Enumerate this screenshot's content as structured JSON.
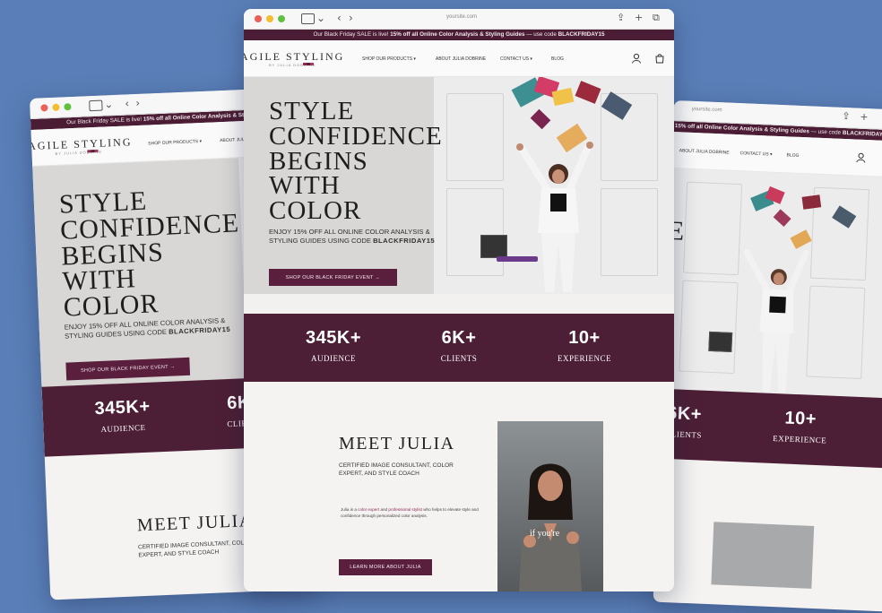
{
  "browser": {
    "url": "yoursite.com",
    "icons": [
      "sidebar-icon",
      "chevron-down-icon",
      "back-icon",
      "forward-icon",
      "share-icon",
      "new-tab-icon",
      "tabs-icon"
    ]
  },
  "banner": {
    "text_left": "Our Black Friday SALE is live!",
    "text_bold": "15% off all Online Color Analysis & Styling Guides",
    "text_right": "— use code",
    "code": "BLACKFRIDAY15"
  },
  "site": {
    "logo": "AGILE STYLING",
    "logo_sub": "BY JULIA DOBRINE",
    "menu": [
      "SHOP OUR PRODUCTS ▾",
      "ABOUT JULIA DOBRINE",
      "CONTACT US ▾",
      "BLOG"
    ]
  },
  "hero": {
    "heading": [
      "STYLE",
      "CONFIDENCE",
      "BEGINS",
      "WITH",
      "COLOR"
    ],
    "sub_line1": "ENJOY 15% OFF ALL ONLINE COLOR ANALYSIS &",
    "sub_line2": "STYLING GUIDES USING CODE",
    "code": "BLACKFRIDAY15",
    "cta": "SHOP OUR BLACK FRIDAY EVENT →"
  },
  "stats": [
    {
      "value": "345K+",
      "label": "AUDIENCE"
    },
    {
      "value": "6K+",
      "label": "CLIENTS"
    },
    {
      "value": "10+",
      "label": "EXPERIENCE"
    }
  ],
  "meet": {
    "title": "MEET JULIA",
    "subtitle_line1": "CERTIFIED IMAGE CONSULTANT, COLOR",
    "subtitle_line2": "EXPERT, AND STYLE COACH",
    "body_a": "Julia is a ",
    "body_hl1": "color expert",
    "body_b": " and ",
    "body_hl2": "professional stylist",
    "body_c": " who helps to elevate style and confidence through personalized color analysis.",
    "cta": "LEARN MORE ABOUT JULIA",
    "video_caption": "if you're"
  },
  "colors": {
    "background": "#5a7fb8",
    "brand": "#4d1f36",
    "accent": "#8a2a56"
  }
}
